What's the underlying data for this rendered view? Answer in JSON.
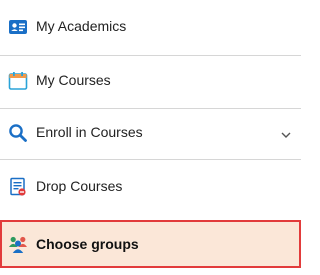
{
  "menu": {
    "items": [
      {
        "label": "My Academics",
        "icon": "id-card-icon"
      },
      {
        "label": "My Courses",
        "icon": "calendar-icon"
      },
      {
        "label": "Enroll in Courses",
        "icon": "search-icon",
        "has_submenu": true
      },
      {
        "label": "Drop Courses",
        "icon": "document-remove-icon"
      },
      {
        "label": "Choose groups",
        "icon": "people-group-icon",
        "active": true
      }
    ]
  },
  "colors": {
    "accent_blue": "#1a6fc6",
    "active_background": "#fbe7d8",
    "active_border": "#e23b3b",
    "divider": "#d6d6d6"
  }
}
